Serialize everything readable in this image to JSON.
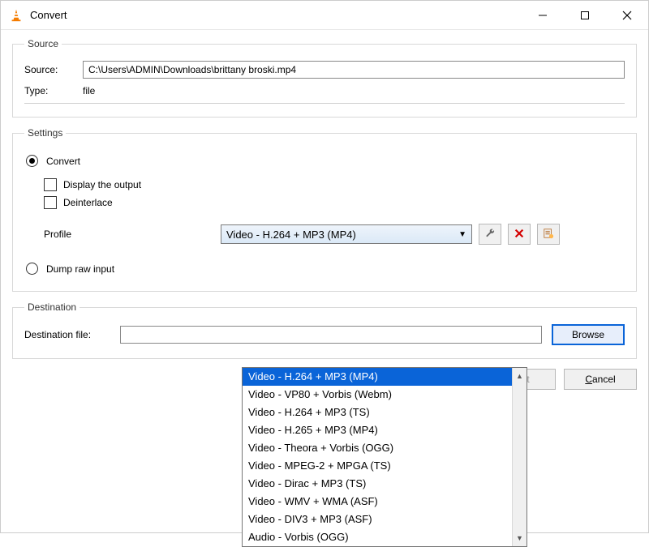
{
  "window": {
    "title": "Convert"
  },
  "source_section": {
    "legend": "Source",
    "source_label": "Source:",
    "source_value": "C:\\Users\\ADMIN\\Downloads\\brittany broski.mp4",
    "type_label": "Type:",
    "type_value": "file"
  },
  "settings_section": {
    "legend": "Settings",
    "convert_label": "Convert",
    "display_output_label": "Display the output",
    "deinterlace_label": "Deinterlace",
    "profile_label": "Profile",
    "profile_selected": "Video - H.264 + MP3 (MP4)",
    "dump_raw_label": "Dump raw input",
    "profile_options": [
      "Video - H.264 + MP3 (MP4)",
      "Video - VP80 + Vorbis (Webm)",
      "Video - H.264 + MP3 (TS)",
      "Video - H.265 + MP3 (MP4)",
      "Video - Theora + Vorbis (OGG)",
      "Video - MPEG-2 + MPGA (TS)",
      "Video - Dirac + MP3 (TS)",
      "Video - WMV + WMA (ASF)",
      "Video - DIV3 + MP3 (ASF)",
      "Audio - Vorbis (OGG)"
    ]
  },
  "destination_section": {
    "legend": "Destination",
    "dest_label": "Destination file:",
    "dest_value": "",
    "browse_label": "Browse"
  },
  "buttons": {
    "start_label": "Start",
    "cancel_label": "Cancel"
  },
  "icons": {
    "wrench": "wrench-icon",
    "delete": "delete-icon",
    "new_profile": "new-profile-icon"
  }
}
